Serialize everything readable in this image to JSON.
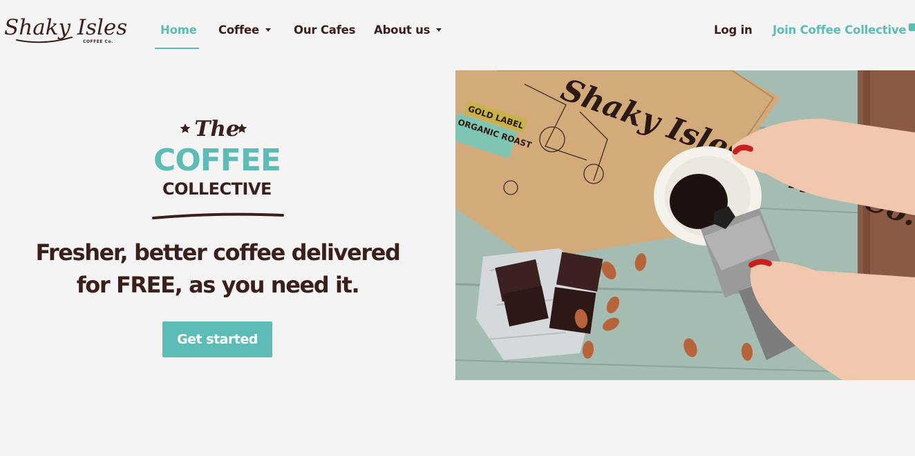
{
  "brand": {
    "logo_text": "Shaky Isles",
    "logo_sub": "COFFEE Co."
  },
  "nav": {
    "items": [
      {
        "label": "Home",
        "active": true
      },
      {
        "label": "Coffee",
        "dropdown": true
      },
      {
        "label": "Our Cafes"
      },
      {
        "label": "About us",
        "dropdown": true
      }
    ],
    "login_label": "Log in",
    "join_label": "Join Coffee Collective",
    "join_icon": "coffee-cup-icon"
  },
  "hero": {
    "badge": {
      "line1": "The",
      "line2": "COFFEE",
      "line3": "COLLECTIVE"
    },
    "headline_line1": "Fresher, better coffee delivered",
    "headline_line2": "for FREE, as you need it.",
    "cta_label": "Get started",
    "photo_bag_text": {
      "brand": "Shaky Isles Coffee Co.",
      "label_1": "GOLD LABEL",
      "label_2": "ORGANIC ROAST"
    }
  },
  "colors": {
    "background": "#f4f4f4",
    "brown": "#3a1f1a",
    "teal": "#5dbcb5"
  }
}
